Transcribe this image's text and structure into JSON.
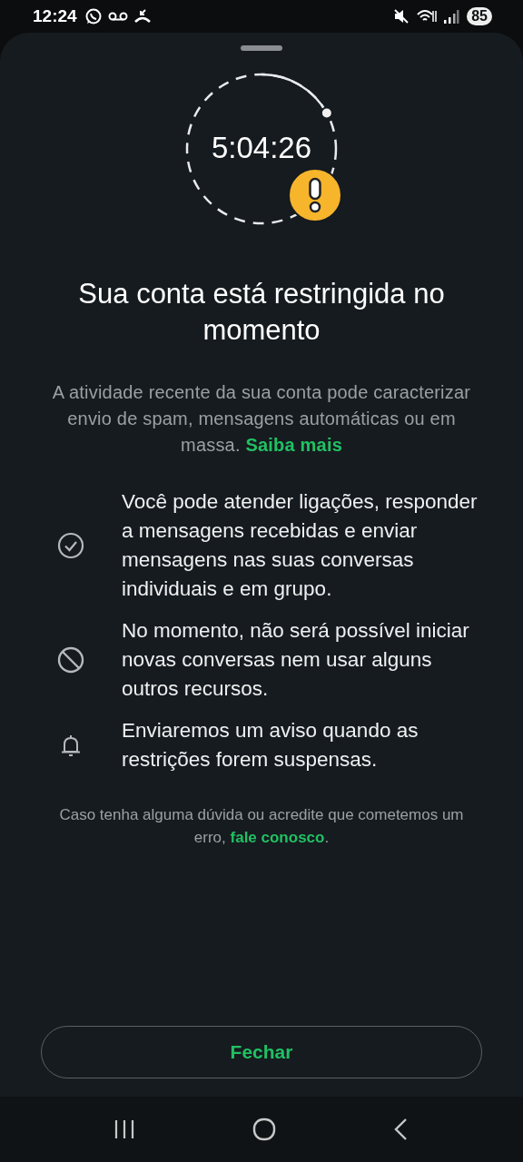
{
  "status_bar": {
    "time": "12:24",
    "battery": "85"
  },
  "timer": {
    "time": "5:04:26",
    "level": 0.17
  },
  "title": "Sua conta está restringida no momento",
  "description": {
    "text": "A atividade recente da sua conta pode caracterizar envio de spam, mensagens automáticas ou em massa.",
    "link": "Saiba mais"
  },
  "items": [
    {
      "kind": "check",
      "text": "Você pode atender ligações, responder a mensagens recebidas e enviar mensagens nas suas conversas individuais e em grupo."
    },
    {
      "kind": "blocked",
      "text": "No momento, não será possível iniciar novas conversas nem usar alguns outros recursos."
    },
    {
      "kind": "bell",
      "text": "Enviaremos um aviso quando as restrições forem suspensas."
    }
  ],
  "footer": {
    "text": "Caso tenha alguma dúvida ou acredite que cometemos um erro,",
    "link": "fale conosco",
    "end": "."
  },
  "button": "Fechar"
}
